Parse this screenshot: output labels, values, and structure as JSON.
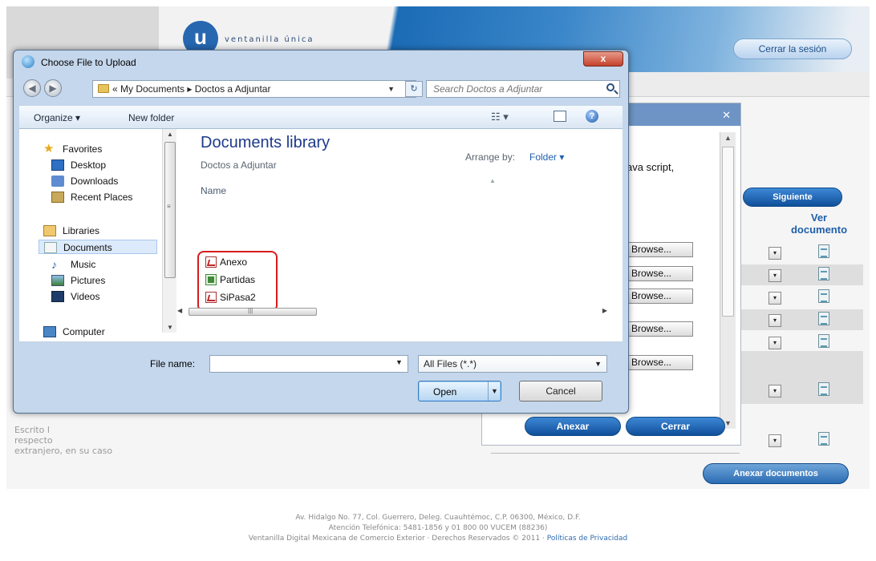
{
  "website": {
    "logo_letter": "u",
    "logo_text": "ventanilla única",
    "logout_label": "Cerrar la sesión",
    "modal_text": "ava script,",
    "browse_label": "Browse...",
    "next_label": "Siguiente",
    "ver_documento_label": "Ver documento",
    "anexar_label": "Anexar",
    "cerrar_label": "Cerrar",
    "anexar_documentos_label": "Anexar documentos",
    "select_arrow": "▾",
    "description_lines": [
      "Escrito l",
      "respecto",
      "extranjero, en su caso"
    ],
    "footer_address": "Av. Hidalgo No. 77, Col. Guerrero, Deleg. Cuauhtémoc, C.P. 06300, México, D.F.",
    "footer_phone": "Atención Telefónica: 5481-1856 y 01 800 00 VUCEM (88236)",
    "footer_rights": "Ventanilla Digital Mexicana de Comercio Exterior · Derechos Reservados © 2011 · ",
    "footer_privacy_link": "Políticas de Privacidad"
  },
  "dialog": {
    "title": "Choose File to Upload",
    "close_glyph": "x",
    "breadcrumb": "« My Documents ▸ Doctos a Adjuntar",
    "search_placeholder": "Search Doctos a Adjuntar",
    "toolbar": {
      "organize": "Organize ▾",
      "new_folder": "New folder"
    },
    "nav": {
      "favorites": "Favorites",
      "desktop": "Desktop",
      "downloads": "Downloads",
      "recent_places": "Recent Places",
      "libraries": "Libraries",
      "documents": "Documents",
      "music": "Music",
      "pictures": "Pictures",
      "videos": "Videos",
      "computer": "Computer"
    },
    "library_title": "Documents library",
    "library_subtitle": "Doctos a Adjuntar",
    "arrange_by_label": "Arrange by:",
    "arrange_by_value": "Folder ▾",
    "column_name": "Name",
    "files": [
      {
        "name": "Anexo",
        "type": "pdf"
      },
      {
        "name": "Partidas",
        "type": "xls"
      },
      {
        "name": "SiPasa2",
        "type": "pdf"
      }
    ],
    "file_name_label": "File name:",
    "file_name_value": "",
    "filter_value": "All Files (*.*)",
    "open_label": "Open",
    "cancel_label": "Cancel"
  },
  "colors": {
    "accent_blue": "#1a5fa8",
    "highlight_red": "#d81b1b",
    "library_title": "#1e3a8a"
  }
}
